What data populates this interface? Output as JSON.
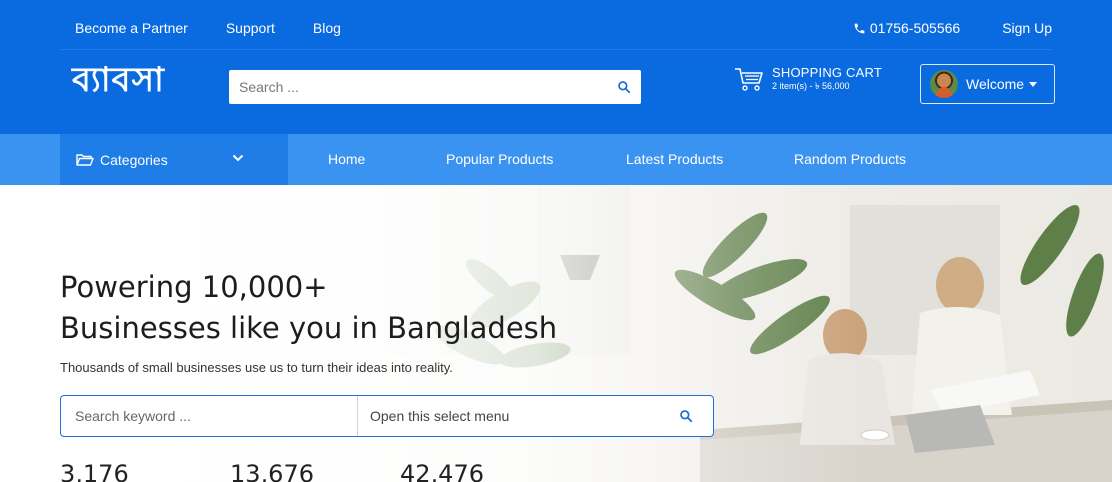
{
  "colors": {
    "brand_blue": "#0a6ae0",
    "nav_blue": "#3a93f1",
    "categories_blue": "#1e7de6",
    "search_border": "#1f6fd6"
  },
  "topbar": {
    "links": [
      "Become a Partner",
      "Support",
      "Blog"
    ],
    "phone": "01756-505566",
    "signup": "Sign Up"
  },
  "header": {
    "logo": "ব্যাবসা",
    "search_placeholder": "Search ...",
    "cart_title": "SHOPPING CART",
    "cart_summary": "2 item(s) - ৳ 56,000",
    "welcome": "Welcome"
  },
  "nav": {
    "categories": "Categories",
    "links": [
      "Home",
      "Popular Products",
      "Latest Products",
      "Random Products"
    ]
  },
  "hero": {
    "title_line1": "Powering 10,000+",
    "title_line2": "Businesses like you in Bangladesh",
    "subtitle": "Thousands of small businesses use us to turn their ideas into reality.",
    "keyword_placeholder": "Search keyword ...",
    "select_placeholder": "Open this select menu",
    "stats": [
      "3,176",
      "13,676",
      "42,476"
    ]
  },
  "icons": [
    "phone-icon",
    "search-icon",
    "cart-icon",
    "user-avatar",
    "caret-down-icon",
    "folder-open-icon",
    "chevron-down-icon"
  ]
}
